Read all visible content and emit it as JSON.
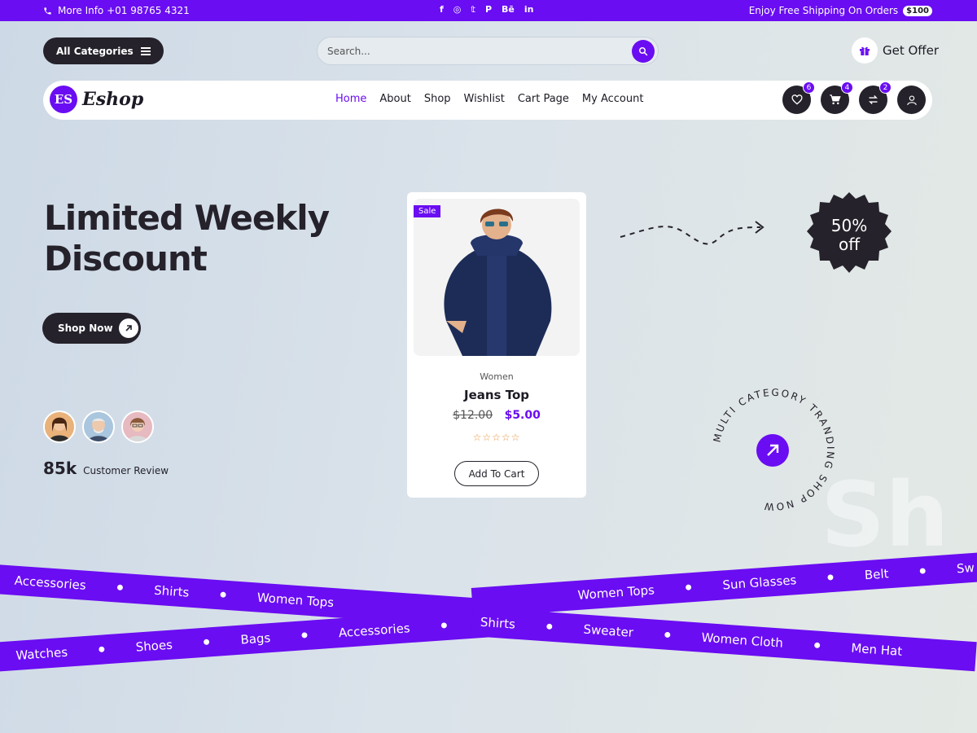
{
  "topbar": {
    "phone_text": "More Info +01 98765 4321",
    "social": [
      "f",
      "◎",
      "𝕥",
      "P",
      "Bē",
      "in"
    ],
    "shipping_text": "Enjoy Free Shipping On Orders",
    "shipping_badge": "$100"
  },
  "header": {
    "all_categories": "All Categories",
    "search_placeholder": "Search...",
    "get_offer": "Get Offer"
  },
  "nav": {
    "logo_mark": "ES",
    "logo_text": "Eshop",
    "menu": [
      "Home",
      "About",
      "Shop",
      "Wishlist",
      "Cart Page",
      "My Account"
    ],
    "active": "Home",
    "counts": {
      "wishlist": "6",
      "cart": "4",
      "compare": "2"
    }
  },
  "hero": {
    "title": "Limited Weekly Discount",
    "shop_now": "Shop Now",
    "review_count": "85k",
    "review_label": "Customer Review",
    "discount_line1": "50%",
    "discount_line2": "off",
    "circle_text": "MULTI CATEGORY TRANDING SHOP NOW",
    "watermark": "Sh"
  },
  "product": {
    "badge": "Sale",
    "category": "Women",
    "name": "Jeans Top",
    "old_price": "$12.00",
    "new_price": "$5.00",
    "stars": "☆☆☆☆☆",
    "add_to_cart": "Add To Cart"
  },
  "ribbons": {
    "top": [
      "Accessories",
      "Shirts",
      "Women Tops",
      "Women Tops",
      "Sun Glasses",
      "Belt",
      "Sw"
    ],
    "bottom": [
      "Watches",
      "Shoes",
      "Bags",
      "Accessories",
      "Shirts",
      "Sweater",
      "Women Cloth",
      "Men Hat"
    ]
  },
  "colors": {
    "accent": "#6a0df2",
    "dark": "#25222b",
    "star": "#e8933a"
  }
}
